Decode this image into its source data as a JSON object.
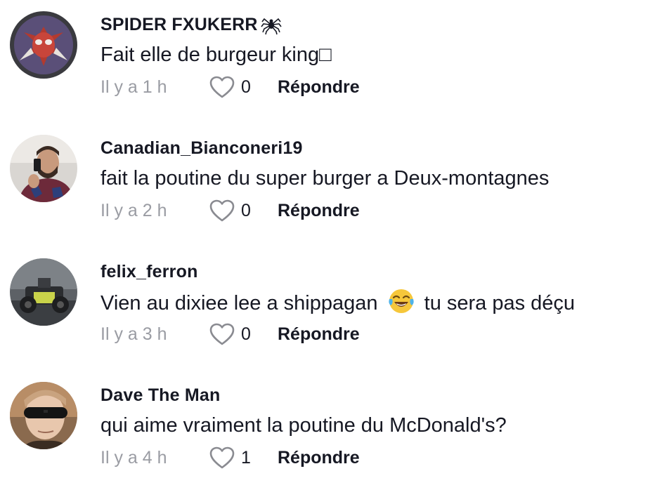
{
  "comments": [
    {
      "username": "SPIDER FXUKERR",
      "username_emoji": "spider-emoji",
      "text": "Fait elle de burgeur king□",
      "time": "Il y a 1 h",
      "likes": "0",
      "reply_label": "Répondre"
    },
    {
      "username": "Canadian_Bianconeri19",
      "text": "fait la poutine du super burger a Deux-montagnes",
      "time": "Il y a 2 h",
      "likes": "0",
      "reply_label": "Répondre"
    },
    {
      "username": "felix_ferron",
      "text_before": "Vien au dixiee lee a shippagan",
      "text_emoji": "tears-of-joy-emoji",
      "text_after": "tu sera pas déçu",
      "time": "Il y a 3 h",
      "likes": "0",
      "reply_label": "Répondre"
    },
    {
      "username": "Dave The Man",
      "text": "qui aime vraiment la poutine du McDonald's?",
      "time": "Il y a 4 h",
      "likes": "1",
      "reply_label": "Répondre"
    }
  ],
  "icons": {
    "like": "heart-outline-icon"
  },
  "colors": {
    "text": "#161823",
    "muted": "#9a9ca3"
  }
}
